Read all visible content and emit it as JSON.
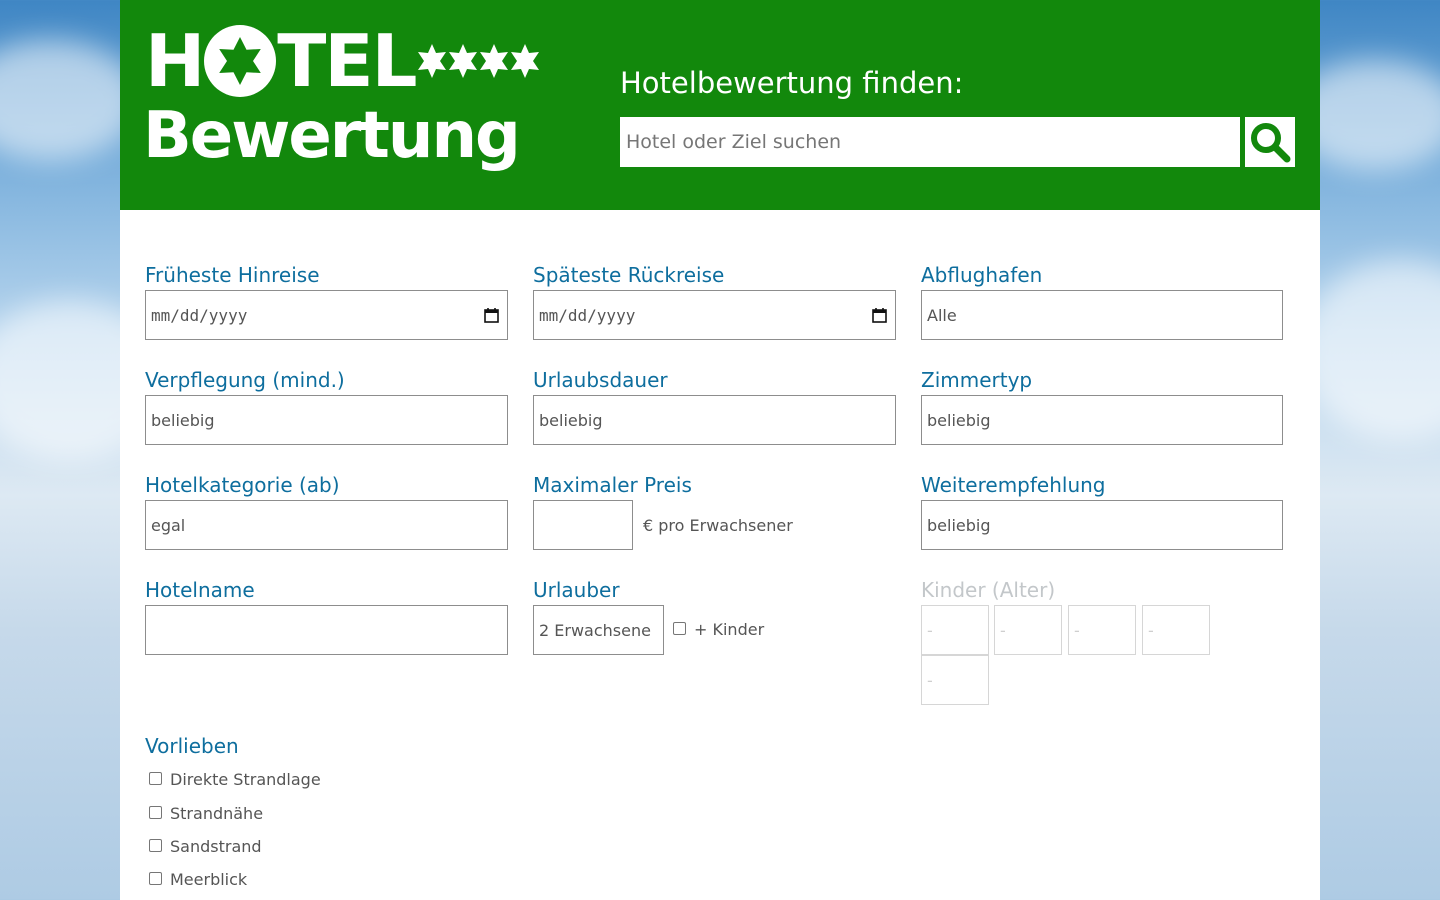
{
  "logo": {
    "line1": "HOTEL",
    "line2": "Bewertung",
    "stars": 4
  },
  "search": {
    "title": "Hotelbewertung finden:",
    "placeholder": "Hotel oder Ziel suchen",
    "icon": "search-icon"
  },
  "form": {
    "earliest_departure": {
      "label": "Früheste Hinreise",
      "placeholder": "mm/dd/yyyy"
    },
    "latest_return": {
      "label": "Späteste Rückreise",
      "placeholder": "mm/dd/yyyy"
    },
    "airport": {
      "label": "Abflughafen",
      "value": "Alle"
    },
    "board": {
      "label": "Verpflegung (mind.)",
      "value": "beliebig"
    },
    "duration": {
      "label": "Urlaubsdauer",
      "value": "beliebig"
    },
    "room_type": {
      "label": "Zimmertyp",
      "value": "beliebig"
    },
    "category": {
      "label": "Hotelkategorie (ab)",
      "value": "egal"
    },
    "max_price": {
      "label": "Maximaler Preis",
      "value": "",
      "suffix": "€ pro Erwachsener"
    },
    "recommendation": {
      "label": "Weiterempfehlung",
      "value": "beliebig"
    },
    "hotel_name": {
      "label": "Hotelname",
      "value": ""
    },
    "travelers": {
      "label": "Urlauber",
      "value": "2 Erwachsene",
      "kids_checkbox_label": "+ Kinder"
    },
    "children_ages": {
      "label": "Kinder (Alter)",
      "values": [
        "-",
        "-",
        "-",
        "-",
        "-"
      ]
    }
  },
  "preferences": {
    "title": "Vorlieben",
    "items": [
      "Direkte Strandlage",
      "Strandnähe",
      "Sandstrand",
      "Meerblick"
    ]
  },
  "colors": {
    "header_green": "#12880c",
    "label_blue": "#0e6e9e"
  }
}
